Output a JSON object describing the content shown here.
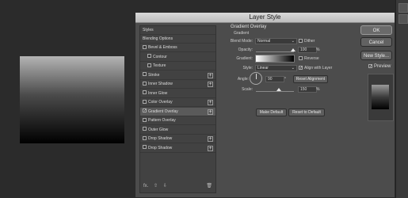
{
  "dialog": {
    "title": "Layer Style"
  },
  "left_panel": {
    "styles_label": "Styles",
    "blending_label": "Blending Options",
    "items": [
      {
        "label": "Bevel & Emboss",
        "checked": false,
        "plus": false
      },
      {
        "label": "Contour",
        "checked": false,
        "plus": false,
        "sub": true
      },
      {
        "label": "Texture",
        "checked": false,
        "plus": false,
        "sub": true
      },
      {
        "label": "Stroke",
        "checked": false,
        "plus": true
      },
      {
        "label": "Inner Shadow",
        "checked": false,
        "plus": true
      },
      {
        "label": "Inner Glow",
        "checked": false,
        "plus": false
      },
      {
        "label": "Color Overlay",
        "checked": false,
        "plus": true
      },
      {
        "label": "Gradient Overlay",
        "checked": true,
        "plus": true,
        "selected": true
      },
      {
        "label": "Pattern Overlay",
        "checked": false,
        "plus": false
      },
      {
        "label": "Outer Glow",
        "checked": false,
        "plus": false
      },
      {
        "label": "Drop Shadow",
        "checked": false,
        "plus": true
      },
      {
        "label": "Drop Shadow",
        "checked": false,
        "plus": true
      }
    ],
    "footer": {
      "fx": "fx.",
      "up": "⇧",
      "down": "⇩",
      "trash": "🗑"
    }
  },
  "gradient_overlay": {
    "section_title": "Gradient Overlay",
    "section_sub": "Gradient",
    "blend_mode_label": "Blend Mode:",
    "blend_mode_value": "Normal",
    "dither_label": "Dither",
    "opacity_label": "Opacity:",
    "opacity_value": "100",
    "percent": "%",
    "gradient_label": "Gradient:",
    "reverse_label": "Reverse",
    "style_label": "Style:",
    "style_value": "Linear",
    "align_label": "Align with Layer",
    "angle_label": "Angle:",
    "angle_value": "90",
    "degree": "°",
    "reset_alignment": "Reset Alignment",
    "scale_label": "Scale:",
    "scale_value": "150",
    "make_default": "Make Default",
    "reset_default": "Reset to Default"
  },
  "buttons": {
    "ok": "OK",
    "cancel": "Cancel",
    "new_style": "New Style..."
  },
  "preview": {
    "label": "Preview",
    "checked": true
  }
}
